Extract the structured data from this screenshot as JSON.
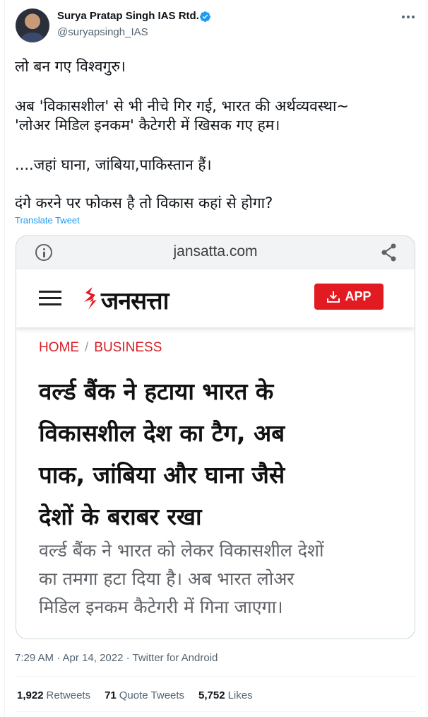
{
  "author": {
    "name": "Surya Pratap Singh IAS Rtd.",
    "handle": "@suryapsingh_IAS"
  },
  "tweet": {
    "lines": [
      "लो बन गए विश्वगुरु।",
      "अब 'विकासशील' से भी नीचे गिर गई, भारत की अर्थव्यवस्था~",
      "'लोअर मिडिल इनकम' कैटेगरी में खिसक गए हम।",
      "....जहां घाना, जांबिया,पाकिस्तान हैं।",
      "दंगे करने पर फोकस है तो विकास कहां से होगा?"
    ],
    "translate_label": "Translate Tweet"
  },
  "card": {
    "domain": "jansatta.com",
    "logo_text": "जनसत्ता",
    "app_button_label": "APP",
    "breadcrumb": [
      "HOME",
      "BUSINESS"
    ],
    "breadcrumb_sep": "/",
    "headline_lines": [
      "वर्ल्ड बैंक ने हटाया भारत के",
      "विकासशील देश का टैग, अब",
      "पाक, जांबिया और घाना जैसे",
      "देशों के बराबर रखा"
    ],
    "summary_lines": [
      "वर्ल्ड बैंक ने भारत को लेकर विकासशील देशों",
      "का तमगा हटा दिया है। अब भारत लोअर",
      "मिडिल इनकम कैटेगरी में गिना जाएगा।"
    ],
    "accent_color": "#e21a22"
  },
  "meta": {
    "timestamp": "7:29 AM · Apr 14, 2022 · Twitter for Android"
  },
  "stats": {
    "retweets_count": "1,922",
    "retweets_label": "Retweets",
    "quotes_count": "71",
    "quotes_label": "Quote Tweets",
    "likes_count": "5,752",
    "likes_label": "Likes"
  },
  "icons": [
    "verified-badge-icon",
    "more-options-icon",
    "info-icon",
    "share-icon",
    "hamburger-menu-icon",
    "jansatta-logo-icon",
    "download-icon"
  ]
}
